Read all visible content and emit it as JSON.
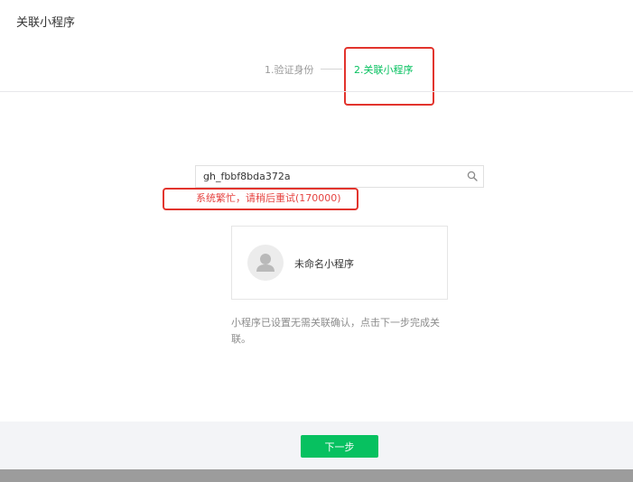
{
  "header": {
    "title": "关联小程序"
  },
  "steps": [
    {
      "label": "1.验证身份",
      "state": "done"
    },
    {
      "label": "2.关联小程序",
      "state": "active"
    }
  ],
  "search": {
    "value": "gh_fbbf8bda372a",
    "icon": "search-icon"
  },
  "error": {
    "message": "系统繁忙，请稍后重试(170000)"
  },
  "result": {
    "name": "未命名小程序",
    "avatar_icon": "default-avatar-icon"
  },
  "hint": {
    "text": "小程序已设置无需关联确认，点击下一步完成关联。"
  },
  "footer": {
    "next_label": "下一步"
  },
  "colors": {
    "accent": "#07c160",
    "error": "#e64340",
    "annotation": "#e2342d"
  }
}
